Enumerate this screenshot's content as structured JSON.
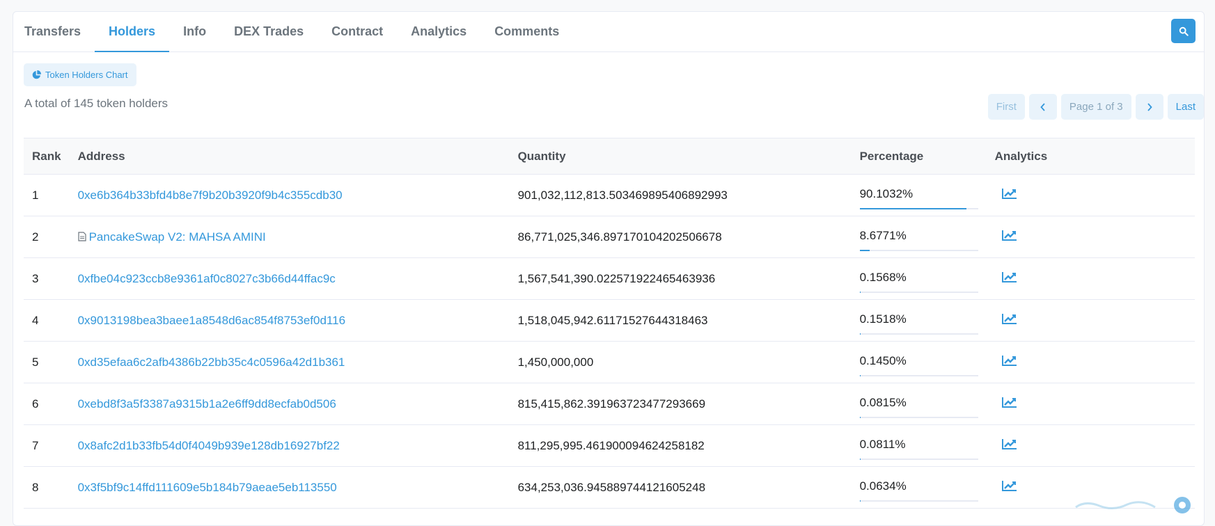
{
  "tabs": [
    {
      "label": "Transfers",
      "active": false
    },
    {
      "label": "Holders",
      "active": true
    },
    {
      "label": "Info",
      "active": false
    },
    {
      "label": "DEX Trades",
      "active": false
    },
    {
      "label": "Contract",
      "active": false
    },
    {
      "label": "Analytics",
      "active": false
    },
    {
      "label": "Comments",
      "active": false
    }
  ],
  "chart_button": {
    "label": "Token Holders Chart",
    "icon": "pie-chart-icon"
  },
  "summary": {
    "total_text": "A total of 145 token holders"
  },
  "pager": {
    "first": "First",
    "prev_icon": "chevron-left-icon",
    "info": "Page 1 of 3",
    "next_icon": "chevron-right-icon",
    "last": "Last"
  },
  "table": {
    "headers": {
      "rank": "Rank",
      "address": "Address",
      "quantity": "Quantity",
      "percentage": "Percentage",
      "analytics": "Analytics"
    },
    "rows": [
      {
        "rank": "1",
        "address": "0xe6b364b33bfd4b8e7f9b20b3920f9b4c355cdb30",
        "contract": false,
        "quantity": "901,032,112,813.503469895406892993",
        "percentage": "90.1032%",
        "pct_value": 90.1032
      },
      {
        "rank": "2",
        "address": "PancakeSwap V2: MAHSA AMINI",
        "contract": true,
        "quantity": "86,771,025,346.897170104202506678",
        "percentage": "8.6771%",
        "pct_value": 8.6771
      },
      {
        "rank": "3",
        "address": "0xfbe04c923ccb8e9361af0c8027c3b66d44ffac9c",
        "contract": false,
        "quantity": "1,567,541,390.022571922465463936",
        "percentage": "0.1568%",
        "pct_value": 0.1568
      },
      {
        "rank": "4",
        "address": "0x9013198bea3baee1a8548d6ac854f8753ef0d116",
        "contract": false,
        "quantity": "1,518,045,942.61171527644318463",
        "percentage": "0.1518%",
        "pct_value": 0.1518
      },
      {
        "rank": "5",
        "address": "0xd35efaa6c2afb4386b22bb35c4c0596a42d1b361",
        "contract": false,
        "quantity": "1,450,000,000",
        "percentage": "0.1450%",
        "pct_value": 0.145
      },
      {
        "rank": "6",
        "address": "0xebd8f3a5f3387a9315b1a2e6ff9dd8ecfab0d506",
        "contract": false,
        "quantity": "815,415,862.391963723477293669",
        "percentage": "0.0815%",
        "pct_value": 0.0815
      },
      {
        "rank": "7",
        "address": "0x8afc2d1b33fb54d0f4049b939e128db16927bf22",
        "contract": false,
        "quantity": "811,295,995.461900094624258182",
        "percentage": "0.0811%",
        "pct_value": 0.0811
      },
      {
        "rank": "8",
        "address": "0x3f5bf9c14ffd111609e5b184b79aeae5eb113550",
        "contract": false,
        "quantity": "634,253,036.945889744121605248",
        "percentage": "0.0634%",
        "pct_value": 0.0634
      }
    ]
  },
  "colors": {
    "accent": "#3498db",
    "muted": "#6c757d",
    "border": "#e7eaf3"
  }
}
